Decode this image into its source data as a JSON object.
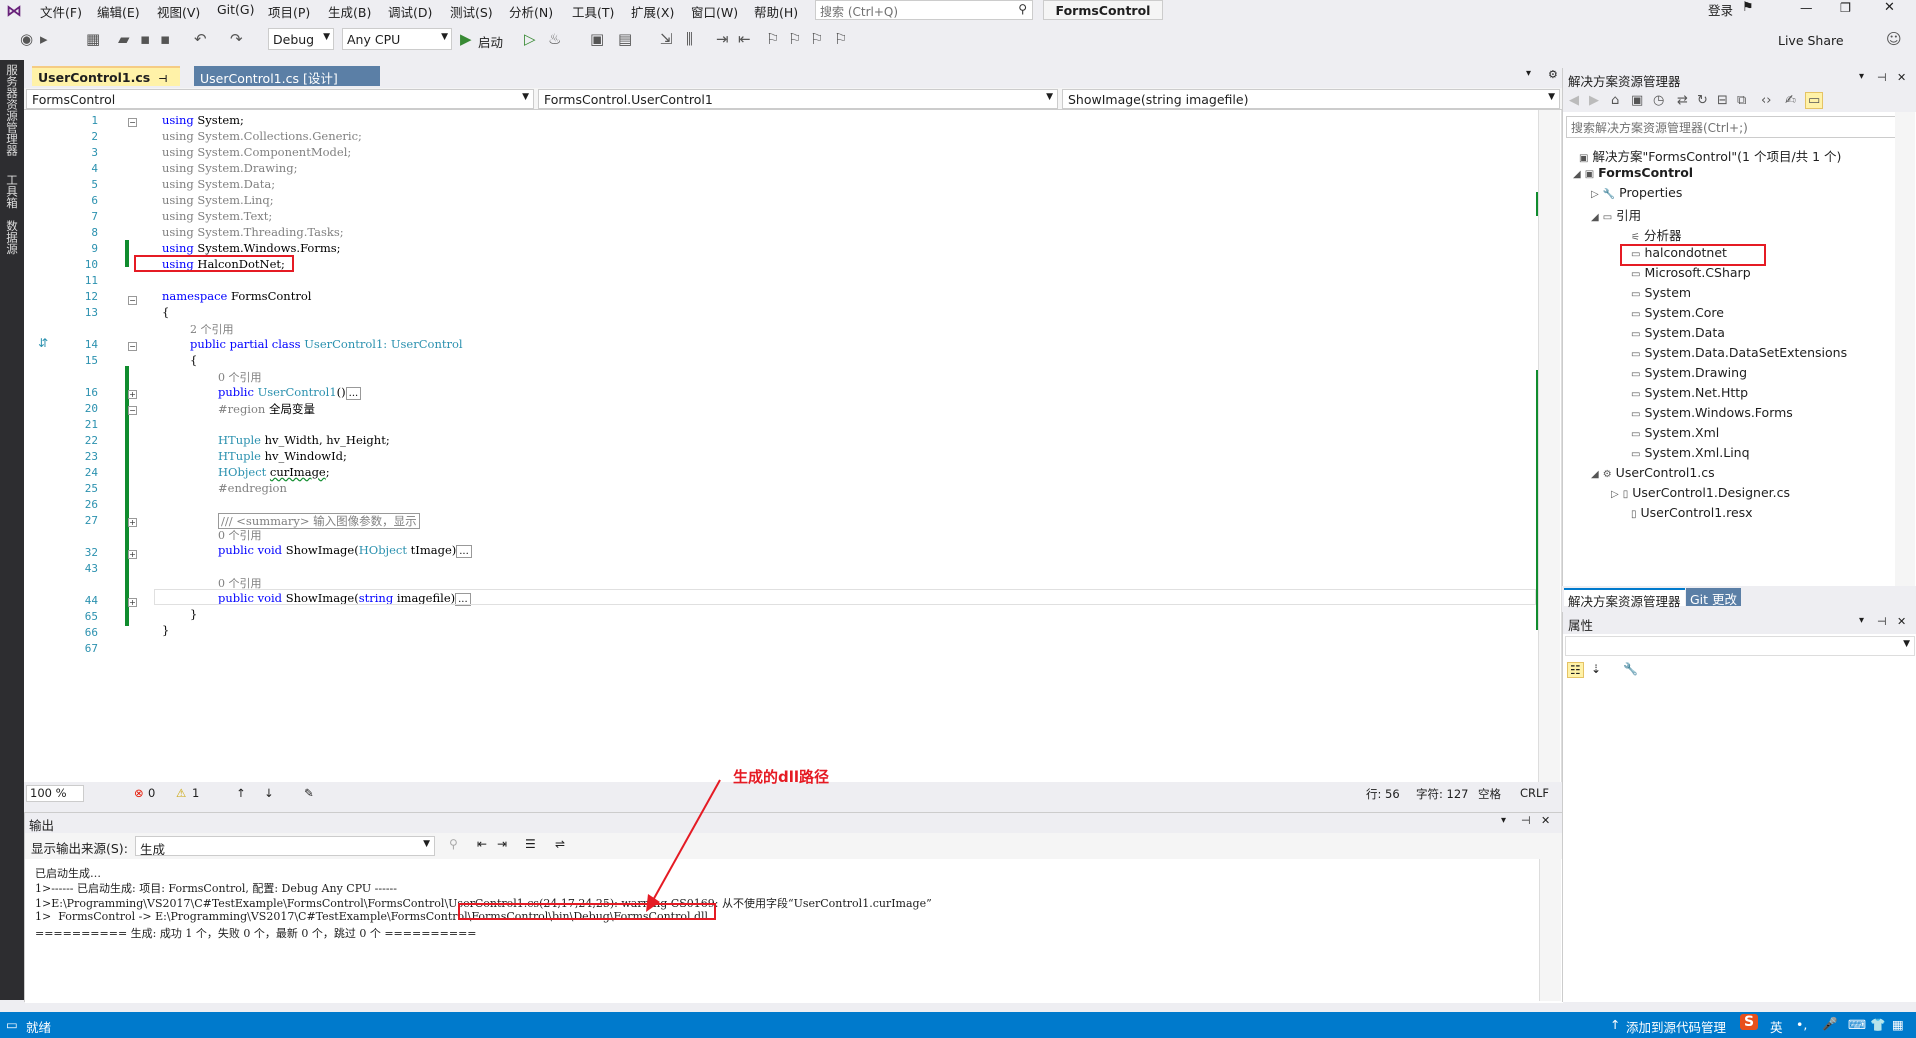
{
  "menubar": {
    "items": [
      "文件(F)",
      "编辑(E)",
      "视图(V)",
      "Git(G)",
      "项目(P)",
      "生成(B)",
      "调试(D)",
      "测试(S)",
      "分析(N)",
      "工具(T)",
      "扩展(X)",
      "窗口(W)",
      "帮助(H)"
    ],
    "search_placeholder": "搜索 (Ctrl+Q)",
    "project_name": "FormsControl",
    "login": "登录",
    "live_share": "Live Share"
  },
  "toolbar": {
    "config": "Debug",
    "platform": "Any CPU",
    "start_label": "启动"
  },
  "left_strip": [
    "服务器资源管理器",
    "工具箱",
    "数据源"
  ],
  "tabs": {
    "active": "UserControl1.cs",
    "active_pin": "⊣ ✕",
    "second": "UserControl1.cs [设计]"
  },
  "nav": {
    "project": "FormsControl",
    "class": "FormsControl.UserControl1",
    "member": "ShowImage(string imagefile)"
  },
  "code": {
    "line_numbers": [
      "1",
      "2",
      "3",
      "4",
      "5",
      "6",
      "7",
      "8",
      "9",
      "10",
      "11",
      "12",
      "13",
      "",
      "14",
      "15",
      "",
      "16",
      "20",
      "21",
      "22",
      "23",
      "24",
      "25",
      "26",
      "27",
      "",
      "32",
      "43",
      "",
      "44",
      "65",
      "66",
      "67"
    ],
    "usings": [
      "System",
      "System.Collections.Generic",
      "System.ComponentModel",
      "System.Drawing",
      "System.Data",
      "System.Linq",
      "System.Text",
      "System.Threading.Tasks",
      "System.Windows.Forms",
      "HalconDotNet"
    ],
    "namespace": "FormsControl",
    "ref2": "2 个引用",
    "ref0": "0 个引用",
    "class_decl": "UserControl1",
    "base_class": "UserControl",
    "ctor": "UserControl1",
    "region": "全局变量",
    "field1": "hv_Width, hv_Height;",
    "field2": "hv_WindowId;",
    "field3": "curImage",
    "endregion": "#endregion",
    "summary": "/// <summary> 输入图像参数，显示",
    "method1": "ShowImage",
    "method1_param": "tImage",
    "method2": "ShowImage",
    "method2_param": "imagefile"
  },
  "status_line": {
    "zoom": "100 %",
    "errors": "0",
    "warnings": "1",
    "row": "行: 56",
    "char": "字符: 127",
    "space": "空格",
    "eol": "CRLF"
  },
  "output": {
    "title": "输出",
    "source_label": "显示输出来源(S):",
    "source_value": "生成",
    "lines": [
      "已启动生成…",
      "1>------ 已启动生成: 项目: FormsControl, 配置: Debug Any CPU ------",
      "1>E:\\Programming\\VS2017\\C#TestExample\\FormsControl\\FormsControl\\UserControl1.cs(24,17,24,25): warning CS0169: 从不使用字段“UserControl1.curImage”",
      "1>  FormsControl -> E:\\Programming\\VS2017\\C#TestExample\\FormsControl\\FormsControl\\bin\\Debug\\FormsControl.dll",
      "========== 生成: 成功 1 个，失败 0 个，最新 0 个，跳过 0 个 =========="
    ]
  },
  "annotation": "生成的dll路径",
  "solution": {
    "title": "解决方案资源管理器",
    "search_placeholder": "搜索解决方案资源管理器(Ctrl+;)",
    "root": "解决方案\"FormsControl\"(1 个项目/共 1 个)",
    "project": "FormsControl",
    "properties": "Properties",
    "refs": "引用",
    "analyzer": "分析器",
    "references": [
      "halcondotnet",
      "Microsoft.CSharp",
      "System",
      "System.Core",
      "System.Data",
      "System.Data.DataSetExtensions",
      "System.Drawing",
      "System.Net.Http",
      "System.Windows.Forms",
      "System.Xml",
      "System.Xml.Linq"
    ],
    "file": "UserControl1.cs",
    "designer": "UserControl1.Designer.cs",
    "resx": "UserControl1.resx",
    "tab1": "解决方案资源管理器",
    "tab2": "Git 更改"
  },
  "properties": {
    "title": "属性"
  },
  "bottombar": {
    "ready": "就绪",
    "source_control": "添加到源代码管理",
    "ime": "英"
  }
}
